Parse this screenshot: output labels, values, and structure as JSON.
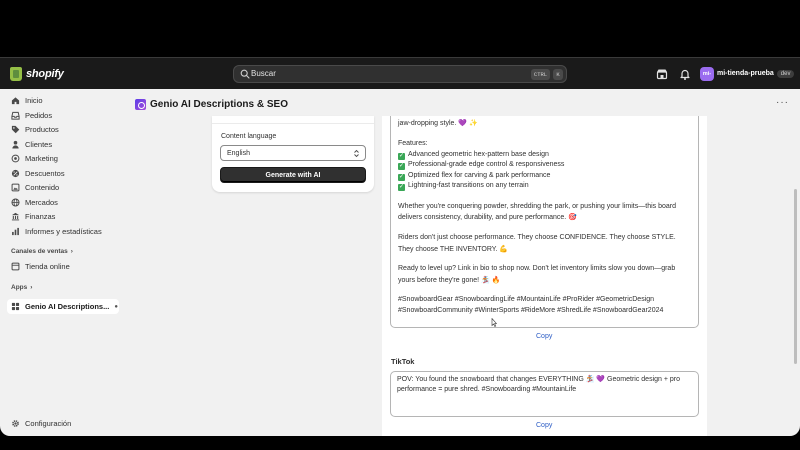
{
  "topbar": {
    "brand": "shopify",
    "search_placeholder": "Buscar",
    "kbd_ctrl": "CTRL",
    "kbd_k": "K",
    "store_initials": "mi-",
    "store_name": "mi-tienda-prueba",
    "store_badge": "dev"
  },
  "sidebar": {
    "items": [
      {
        "label": "Inicio",
        "icon": "home-icon"
      },
      {
        "label": "Pedidos",
        "icon": "inbox-icon"
      },
      {
        "label": "Productos",
        "icon": "tag-icon"
      },
      {
        "label": "Clientes",
        "icon": "person-icon"
      },
      {
        "label": "Marketing",
        "icon": "target-icon"
      },
      {
        "label": "Descuentos",
        "icon": "discount-icon"
      },
      {
        "label": "Contenido",
        "icon": "content-icon"
      },
      {
        "label": "Mercados",
        "icon": "globe-icon"
      },
      {
        "label": "Finanzas",
        "icon": "bank-icon"
      },
      {
        "label": "Informes y estadísticas",
        "icon": "chart-icon"
      }
    ],
    "sales_channels_label": "Canales de ventas",
    "online_store": "Tienda online",
    "apps_label": "Apps",
    "app_genio": "Genio AI Descriptions...",
    "settings": "Configuración"
  },
  "main": {
    "title": "Genio AI Descriptions & SEO",
    "language_label": "Content language",
    "language_value": "English",
    "generate_button": "Generate with AI",
    "instagram_lines": [
      "jaw-dropping style. 💜 ✨",
      "Features:",
      "Advanced geometric hex-pattern base design",
      "Professional-grade edge control & responsiveness",
      "Optimized flex for carving & park performance",
      "Lightning-fast transitions on any terrain",
      "Whether you're conquering powder, shredding the park, or pushing your limits—this board",
      "delivers consistency, durability, and pure performance. 🎯",
      "Riders don't just choose performance. They choose CONFIDENCE. They choose STYLE.",
      "They choose THE INVENTORY. 💪",
      "Ready to level up? Link in bio to shop now. Don't let inventory limits slow you down—grab",
      "yours before they're gone! 🏂 🔥",
      "#SnowboardGear #SnowboardingLife #MountainLife #ProRider #GeometricDesign",
      "#SnowboardCommunity #WinterSports #RideMore #ShredLife #SnowboardGear2024"
    ],
    "copy_label": "Copy",
    "tiktok_title": "TikTok",
    "tiktok_lines": [
      "POV: You found the snowboard that changes EVERYTHING 🏂 💜 Geometric design + pro",
      "performance = pure shred. #Snowboarding #MountainLife"
    ]
  },
  "colors": {
    "topbar_bg": "#1a1a1a",
    "app_bg": "#f1f1f1",
    "accent_link": "#2c5cc5",
    "check_green": "#3aa757",
    "store_avatar": "#9b6cf0"
  }
}
